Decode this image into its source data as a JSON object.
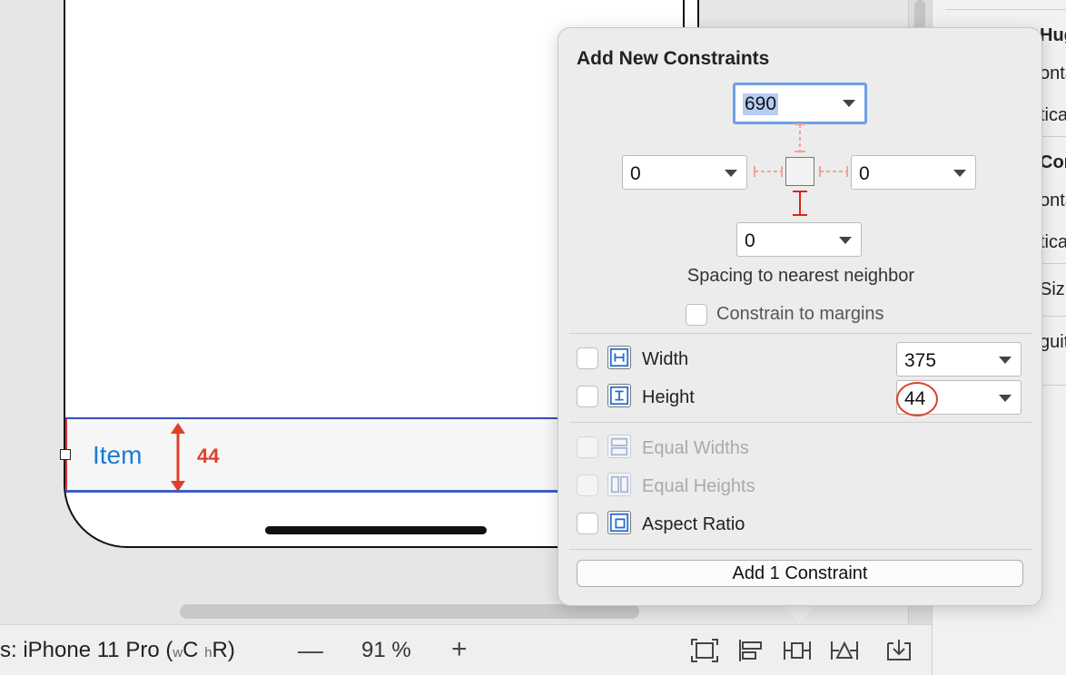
{
  "canvas": {
    "item_label": "Item",
    "height_annotation": "44"
  },
  "popover": {
    "title": "Add New Constraints",
    "top_value": "690",
    "left_value": "0",
    "right_value": "0",
    "bottom_value": "0",
    "spacing_label": "Spacing to nearest neighbor",
    "constrain_margins_label": "Constrain to margins",
    "width_label": "Width",
    "width_value": "375",
    "height_label": "Height",
    "height_value": "44",
    "equal_widths_label": "Equal Widths",
    "equal_heights_label": "Equal Heights",
    "aspect_ratio_label": "Aspect Ratio",
    "add_button_label": "Add 1 Constraint"
  },
  "bottombar": {
    "device_prefix": "s: iPhone 11 Pro (",
    "size_w": "w",
    "size_C": "C",
    "size_h": "h",
    "size_R": "R)",
    "zoom_out": "—",
    "zoom_value": "91 %",
    "zoom_in": "+"
  },
  "inspector": {
    "rows": [
      "Hug",
      "onta",
      "tica",
      "Con",
      "onta",
      "tica",
      "Siz",
      "guit"
    ]
  },
  "colors": {
    "accent_blue": "#1a7ad9",
    "annotation_red": "#e0402a",
    "selection_blue": "#6e9fe6"
  }
}
